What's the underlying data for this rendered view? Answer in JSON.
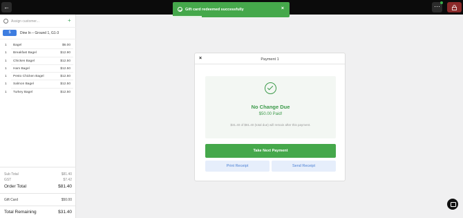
{
  "topbar": {
    "back_icon": "arrow-left-icon",
    "grid_icon": "grid-icon",
    "lock_icon": "lock-icon"
  },
  "toast": {
    "message": "Gift card redeemed successfully",
    "close_glyph": "×",
    "progress": 0.25
  },
  "sidebar": {
    "customer_placeholder": "Assign customer...",
    "dollar_label": "$",
    "dine_text": "Dine In – Ground 1, G1-3",
    "items": [
      {
        "qty": "1",
        "name": "Bagel",
        "price": "$6.00"
      },
      {
        "qty": "1",
        "name": "Breakfast Bagel",
        "price": "$12.90"
      },
      {
        "qty": "1",
        "name": "Chicken Bagel",
        "price": "$12.50"
      },
      {
        "qty": "1",
        "name": "Ham Bagel",
        "price": "$12.50"
      },
      {
        "qty": "1",
        "name": "Pesto Chicken Bagel",
        "price": "$12.50"
      },
      {
        "qty": "1",
        "name": "Salmon Bagel",
        "price": "$12.50"
      },
      {
        "qty": "1",
        "name": "Turkey Bagel",
        "price": "$12.50"
      }
    ],
    "totals": {
      "subtotal_label": "Sub Total",
      "subtotal_value": "$81.40",
      "gst_label": "GST",
      "gst_value": "$7.42",
      "order_total_label": "Order Total",
      "order_total_value": "$81.40",
      "gift_card_label": "Gift Card",
      "gift_card_value": "$50.00",
      "remaining_label": "Total Remaining",
      "remaining_value": "$31.40"
    }
  },
  "modal": {
    "title": "Payment 1",
    "close_glyph": "×",
    "status_title": "No Change Due",
    "status_sub": "$50.00 Paid!",
    "status_note": "$31.40 of $81.40 (total due) will remain after this payment.",
    "take_next_label": "Take Next Payment",
    "print_label": "Print Receipt",
    "send_label": "Send Receipt"
  },
  "colors": {
    "accent_green": "#45a84b",
    "accent_blue": "#3d7de0",
    "lock_red": "#8b2a2a"
  }
}
